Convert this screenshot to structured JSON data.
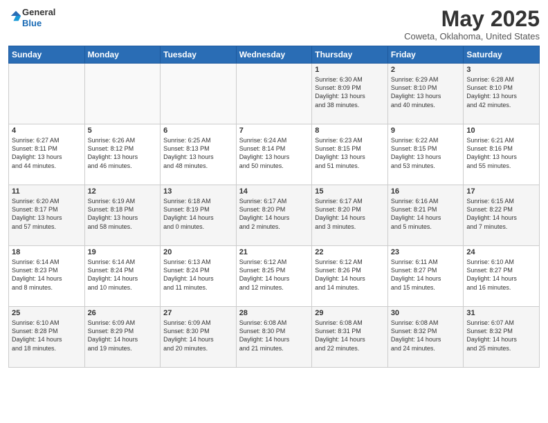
{
  "header": {
    "logo_line1": "General",
    "logo_line2": "Blue",
    "title": "May 2025",
    "subtitle": "Coweta, Oklahoma, United States"
  },
  "days_of_week": [
    "Sunday",
    "Monday",
    "Tuesday",
    "Wednesday",
    "Thursday",
    "Friday",
    "Saturday"
  ],
  "weeks": [
    [
      {
        "day": "",
        "content": ""
      },
      {
        "day": "",
        "content": ""
      },
      {
        "day": "",
        "content": ""
      },
      {
        "day": "",
        "content": ""
      },
      {
        "day": "1",
        "content": "Sunrise: 6:30 AM\nSunset: 8:09 PM\nDaylight: 13 hours\nand 38 minutes."
      },
      {
        "day": "2",
        "content": "Sunrise: 6:29 AM\nSunset: 8:10 PM\nDaylight: 13 hours\nand 40 minutes."
      },
      {
        "day": "3",
        "content": "Sunrise: 6:28 AM\nSunset: 8:10 PM\nDaylight: 13 hours\nand 42 minutes."
      }
    ],
    [
      {
        "day": "4",
        "content": "Sunrise: 6:27 AM\nSunset: 8:11 PM\nDaylight: 13 hours\nand 44 minutes."
      },
      {
        "day": "5",
        "content": "Sunrise: 6:26 AM\nSunset: 8:12 PM\nDaylight: 13 hours\nand 46 minutes."
      },
      {
        "day": "6",
        "content": "Sunrise: 6:25 AM\nSunset: 8:13 PM\nDaylight: 13 hours\nand 48 minutes."
      },
      {
        "day": "7",
        "content": "Sunrise: 6:24 AM\nSunset: 8:14 PM\nDaylight: 13 hours\nand 50 minutes."
      },
      {
        "day": "8",
        "content": "Sunrise: 6:23 AM\nSunset: 8:15 PM\nDaylight: 13 hours\nand 51 minutes."
      },
      {
        "day": "9",
        "content": "Sunrise: 6:22 AM\nSunset: 8:15 PM\nDaylight: 13 hours\nand 53 minutes."
      },
      {
        "day": "10",
        "content": "Sunrise: 6:21 AM\nSunset: 8:16 PM\nDaylight: 13 hours\nand 55 minutes."
      }
    ],
    [
      {
        "day": "11",
        "content": "Sunrise: 6:20 AM\nSunset: 8:17 PM\nDaylight: 13 hours\nand 57 minutes."
      },
      {
        "day": "12",
        "content": "Sunrise: 6:19 AM\nSunset: 8:18 PM\nDaylight: 13 hours\nand 58 minutes."
      },
      {
        "day": "13",
        "content": "Sunrise: 6:18 AM\nSunset: 8:19 PM\nDaylight: 14 hours\nand 0 minutes."
      },
      {
        "day": "14",
        "content": "Sunrise: 6:17 AM\nSunset: 8:20 PM\nDaylight: 14 hours\nand 2 minutes."
      },
      {
        "day": "15",
        "content": "Sunrise: 6:17 AM\nSunset: 8:20 PM\nDaylight: 14 hours\nand 3 minutes."
      },
      {
        "day": "16",
        "content": "Sunrise: 6:16 AM\nSunset: 8:21 PM\nDaylight: 14 hours\nand 5 minutes."
      },
      {
        "day": "17",
        "content": "Sunrise: 6:15 AM\nSunset: 8:22 PM\nDaylight: 14 hours\nand 7 minutes."
      }
    ],
    [
      {
        "day": "18",
        "content": "Sunrise: 6:14 AM\nSunset: 8:23 PM\nDaylight: 14 hours\nand 8 minutes."
      },
      {
        "day": "19",
        "content": "Sunrise: 6:14 AM\nSunset: 8:24 PM\nDaylight: 14 hours\nand 10 minutes."
      },
      {
        "day": "20",
        "content": "Sunrise: 6:13 AM\nSunset: 8:24 PM\nDaylight: 14 hours\nand 11 minutes."
      },
      {
        "day": "21",
        "content": "Sunrise: 6:12 AM\nSunset: 8:25 PM\nDaylight: 14 hours\nand 12 minutes."
      },
      {
        "day": "22",
        "content": "Sunrise: 6:12 AM\nSunset: 8:26 PM\nDaylight: 14 hours\nand 14 minutes."
      },
      {
        "day": "23",
        "content": "Sunrise: 6:11 AM\nSunset: 8:27 PM\nDaylight: 14 hours\nand 15 minutes."
      },
      {
        "day": "24",
        "content": "Sunrise: 6:10 AM\nSunset: 8:27 PM\nDaylight: 14 hours\nand 16 minutes."
      }
    ],
    [
      {
        "day": "25",
        "content": "Sunrise: 6:10 AM\nSunset: 8:28 PM\nDaylight: 14 hours\nand 18 minutes."
      },
      {
        "day": "26",
        "content": "Sunrise: 6:09 AM\nSunset: 8:29 PM\nDaylight: 14 hours\nand 19 minutes."
      },
      {
        "day": "27",
        "content": "Sunrise: 6:09 AM\nSunset: 8:30 PM\nDaylight: 14 hours\nand 20 minutes."
      },
      {
        "day": "28",
        "content": "Sunrise: 6:08 AM\nSunset: 8:30 PM\nDaylight: 14 hours\nand 21 minutes."
      },
      {
        "day": "29",
        "content": "Sunrise: 6:08 AM\nSunset: 8:31 PM\nDaylight: 14 hours\nand 22 minutes."
      },
      {
        "day": "30",
        "content": "Sunrise: 6:08 AM\nSunset: 8:32 PM\nDaylight: 14 hours\nand 24 minutes."
      },
      {
        "day": "31",
        "content": "Sunrise: 6:07 AM\nSunset: 8:32 PM\nDaylight: 14 hours\nand 25 minutes."
      }
    ]
  ]
}
